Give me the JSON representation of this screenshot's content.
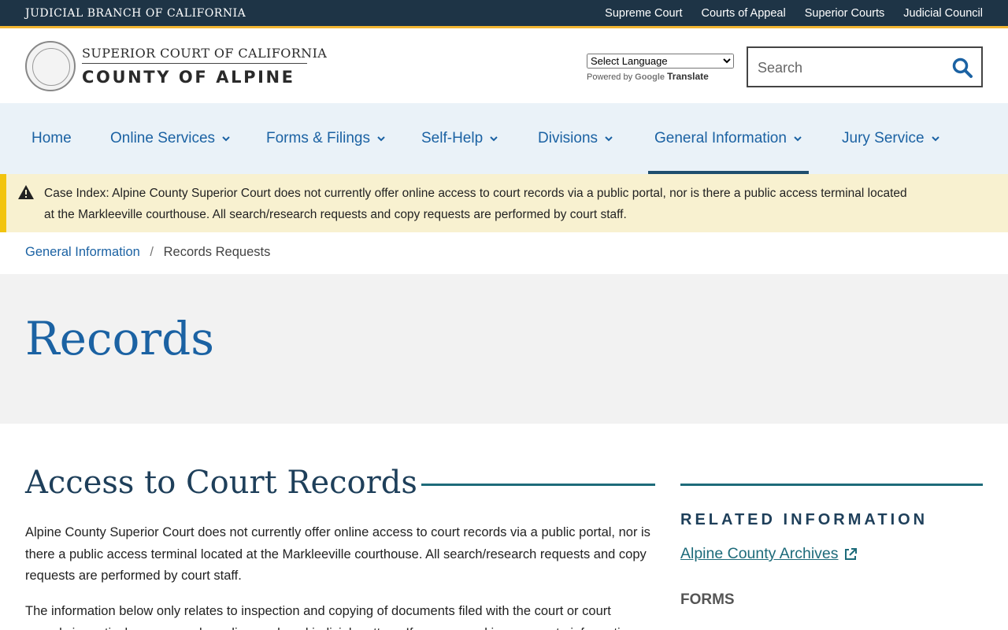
{
  "topbar": {
    "branch": "JUDICIAL BRANCH OF CALIFORNIA",
    "links": [
      "Supreme Court",
      "Courts of Appeal",
      "Superior Courts",
      "Judicial Council"
    ]
  },
  "header": {
    "logo_line1": "SUPERIOR COURT OF CALIFORNIA",
    "logo_line2": "COUNTY OF ALPINE",
    "language_select": "Select Language",
    "powered_by": "Powered by",
    "google": "Google",
    "translate": "Translate",
    "search_placeholder": "Search"
  },
  "nav": {
    "items": [
      "Home",
      "Online Services",
      "Forms & Filings",
      "Self-Help",
      "Divisions",
      "General Information",
      "Jury Service"
    ],
    "active": "General Information"
  },
  "alert": {
    "label": "Case Index:",
    "text": "Alpine County Superior Court does not currently offer online access to court records via a public portal, nor is there a public access terminal located at the Markleeville courthouse. All search/research requests and copy requests are performed by court staff."
  },
  "breadcrumb": {
    "parent": "General Information",
    "separator": "/",
    "current": "Records Requests"
  },
  "hero": {
    "title": "Records"
  },
  "content": {
    "section_title": "Access to Court Records",
    "para1": "Alpine County Superior Court does not currently offer online access to court records via a public portal, nor is there a public access terminal located at the Markleeville courthouse. All search/research requests and copy requests are performed by court staff.",
    "para2": "The information below only relates to inspection and copying of documents filed with the court or court records in particular cases and pending or closed judicial matters. If you are seeking access to information"
  },
  "sidebar": {
    "heading": "RELATED INFORMATION",
    "link": "Alpine County Archives",
    "forms": "FORMS"
  },
  "colors": {
    "topbar_bg": "#1e3446",
    "accent_gold": "#f2b632",
    "link_blue": "#1b62a3",
    "teal": "#1d6b7a",
    "alert_bg": "#f8f1d0",
    "nav_bg": "#eaf2f8"
  }
}
